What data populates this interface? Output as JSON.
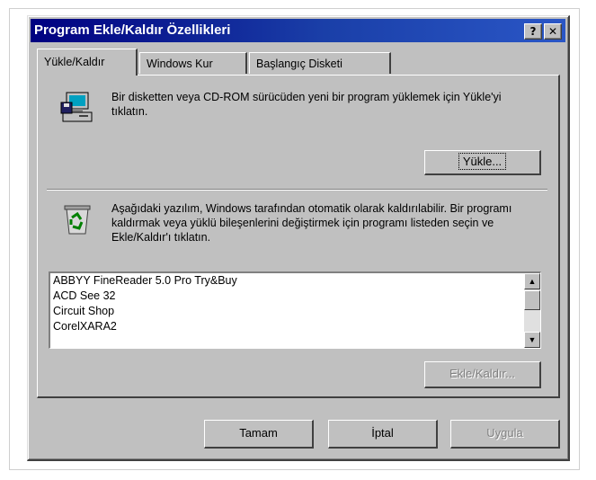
{
  "window": {
    "title": "Program Ekle/Kaldır Özellikleri",
    "help_label": "?",
    "close_label": "✕"
  },
  "tabs": [
    {
      "label": "Yükle/Kaldır",
      "active": true
    },
    {
      "label": "Windows Kur",
      "active": false
    },
    {
      "label": "Başlangıç Disketi",
      "active": false
    }
  ],
  "install_section": {
    "description": "Bir disketten veya CD-ROM sürücüden yeni bir program yüklemek için Yükle'yi tıklatın.",
    "install_button": "Yükle..."
  },
  "remove_section": {
    "description": "Aşağıdaki yazılım, Windows tarafından otomatik olarak kaldırılabilir. Bir programı kaldırmak veya yüklü bileşenlerini değiştirmek için programı listeden seçin ve Ekle/Kaldır'ı tıklatın."
  },
  "program_list": [
    "ABBYY FineReader 5.0 Pro Try&Buy",
    "ACD See 32",
    "Circuit Shop",
    "CorelXARA2"
  ],
  "add_remove_button": "Ekle/Kaldır...",
  "footer": {
    "ok": "Tamam",
    "cancel": "İptal",
    "apply": "Uygula"
  },
  "icons": {
    "install": "computer-with-disk-icon",
    "remove": "recycle-bin-icon",
    "scroll_up": "scroll-up-arrow-icon",
    "scroll_down": "scroll-down-arrow-icon"
  },
  "colors": {
    "titlebar_start": "#000080",
    "titlebar_end": "#2a56c6",
    "face": "#c0c0c0"
  }
}
